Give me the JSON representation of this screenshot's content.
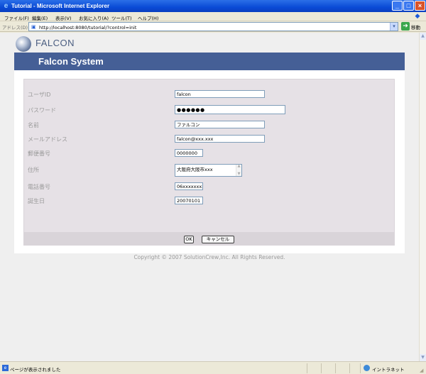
{
  "window": {
    "title": "Tutorial - Microsoft Internet Explorer",
    "min_glyph": "_",
    "max_glyph": "□",
    "close_glyph": "×",
    "app_icon": "ie-icon"
  },
  "menu": {
    "items": [
      "ファイル(F)",
      "編集(E)",
      "表示(V)",
      "お気に入り(A)",
      "ツール(T)",
      "ヘルプ(H)"
    ]
  },
  "address": {
    "label": "アドレス(D)",
    "url": "http://localhost:8080/tutorial/?control=init",
    "go_label": "移動",
    "go_glyph": "➜",
    "dropdown_glyph": "▾"
  },
  "page": {
    "logo_text": "FALCON",
    "banner_title": "Falcon System",
    "form": {
      "userid_label": "ユーザID",
      "userid_value": "falcon",
      "password_label": "パスワード",
      "password_value": "●●●●●●",
      "name_label": "名前",
      "name_value": "ファルコン",
      "email_label": "メールアドレス",
      "email_value": "falcon@xxx.xxx",
      "zip_label": "郵便番号",
      "zip_value": "0000000",
      "address_label": "住所",
      "address_value": "大阪府大阪市xxx",
      "phone_label": "電話番号",
      "phone_value": "06xxxxxxxx",
      "birthday_label": "誕生日",
      "birthday_value": "20070101"
    },
    "buttons": {
      "ok_label": "OK",
      "cancel_label": "キャンセル"
    },
    "copyright": "Copyright © 2007 SolutionCrew,Inc. All Rights Reserved."
  },
  "status": {
    "text": "ページが表示されました",
    "zone": "イントラネット"
  },
  "colors": {
    "banner": "#455f96",
    "form_panel": "#e6e1e6",
    "page_background": "#efefef"
  }
}
